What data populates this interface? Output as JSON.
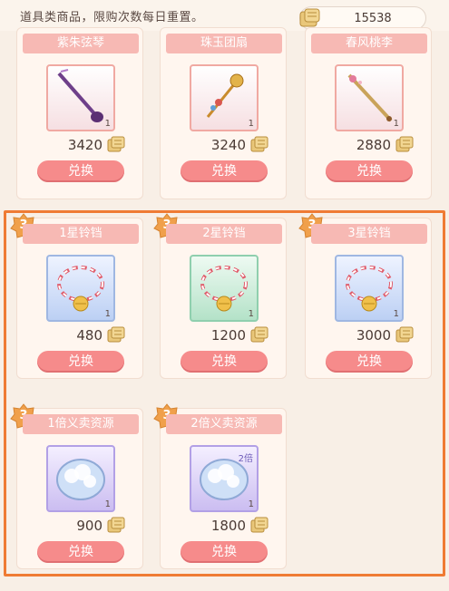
{
  "header": {
    "hint": "道具类商品，限购次数每日重置。",
    "balance": "15538"
  },
  "colors": {
    "button": "#f68b8b",
    "header": "#f7b9b4",
    "highlight": "#ef7b34"
  },
  "items": [
    {
      "name": "紫朱弦琴",
      "price": "3420",
      "qty": "1",
      "button": "兑换",
      "bg": "pink",
      "icon": "pipa-instrument-icon",
      "badge": ""
    },
    {
      "name": "珠玉团扇",
      "price": "3240",
      "qty": "1",
      "button": "兑换",
      "bg": "pink",
      "icon": "hairpin-ornament-icon",
      "badge": ""
    },
    {
      "name": "春风桃李",
      "price": "2880",
      "qty": "1",
      "button": "兑换",
      "bg": "pink",
      "icon": "flute-icon",
      "badge": ""
    },
    {
      "name": "1星铃铛",
      "price": "480",
      "qty": "1",
      "button": "兑换",
      "bg": "blue",
      "icon": "bell-bracelet-icon",
      "badge": "3"
    },
    {
      "name": "2星铃铛",
      "price": "1200",
      "qty": "1",
      "button": "兑换",
      "bg": "green",
      "icon": "bell-bracelet-icon",
      "badge": "3"
    },
    {
      "name": "3星铃铛",
      "price": "3000",
      "qty": "1",
      "button": "兑换",
      "bg": "blue",
      "icon": "bell-bracelet-icon",
      "badge": "3"
    },
    {
      "name": "1倍义卖资源",
      "price": "900",
      "qty": "1",
      "button": "兑换",
      "bg": "purple",
      "icon": "cloud-token-icon",
      "badge": "3"
    },
    {
      "name": "2倍义卖资源",
      "price": "1800",
      "qty": "1",
      "button": "兑换",
      "bg": "purple",
      "icon": "cloud-token-icon",
      "badge": "3",
      "tag": "2倍"
    }
  ]
}
